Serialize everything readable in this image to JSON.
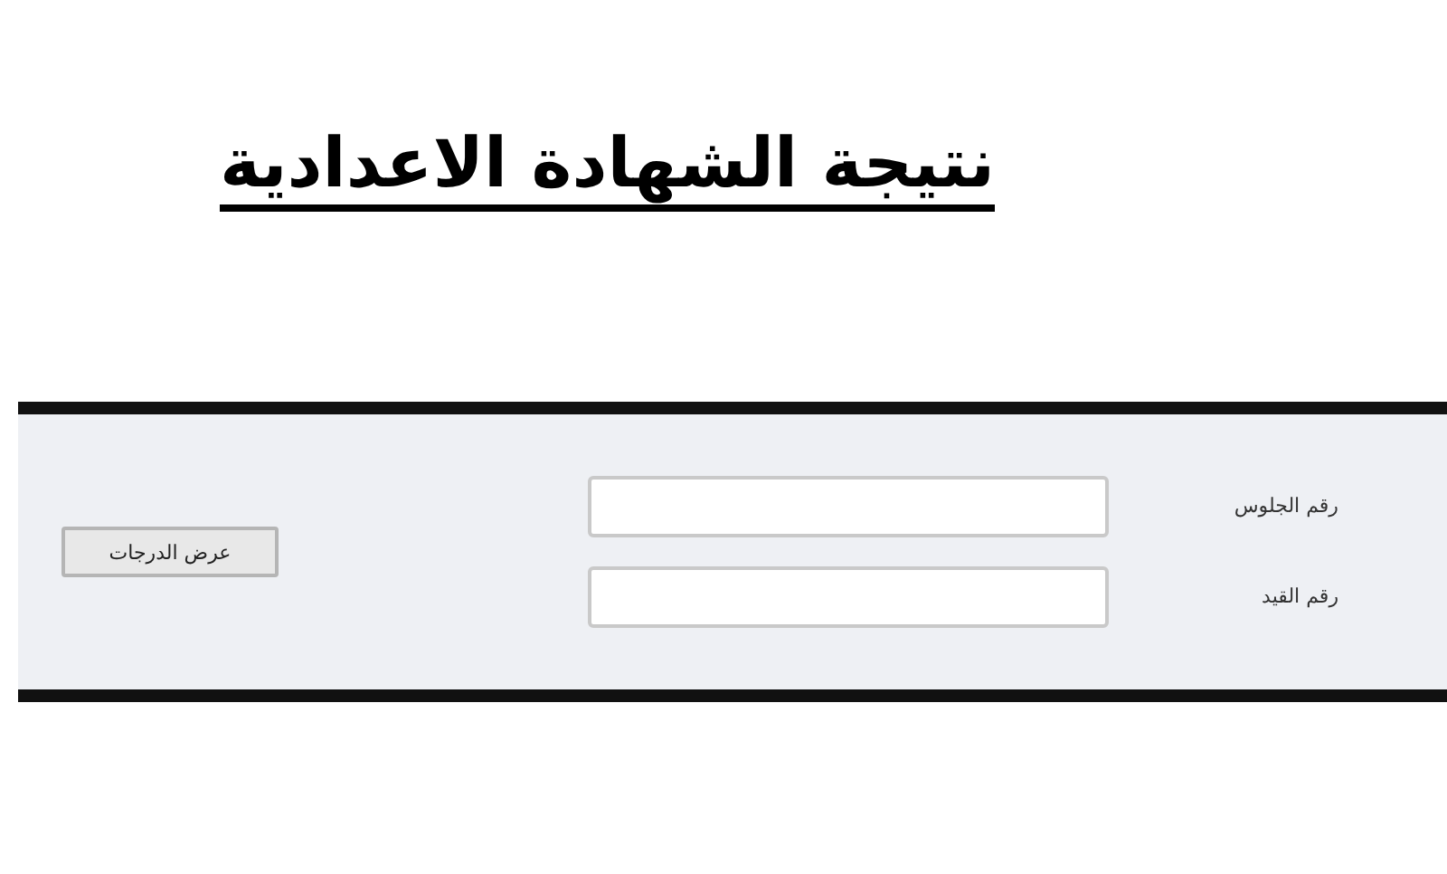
{
  "title": "نتيجة الشهادة الاعدادية",
  "form": {
    "fields": [
      {
        "label": "رقم الجلوس"
      },
      {
        "label": "رقم القيد"
      }
    ],
    "button": "عرض الدرجات"
  }
}
